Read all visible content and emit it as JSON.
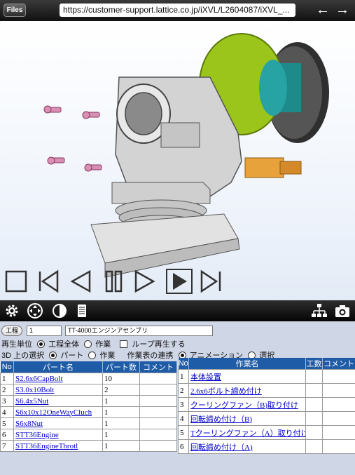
{
  "topbar": {
    "files_label": "Files",
    "url": "https://customer-support.lattice.co.jp/iXVL/L2604087/iXVL_...",
    "back_icon": "back-arrow-icon",
    "forward_icon": "forward-arrow-icon"
  },
  "player": {
    "buttons": [
      "stop",
      "rewind",
      "step-back",
      "pause",
      "step-forward",
      "play",
      "end"
    ]
  },
  "toolbar": {
    "left_icons": [
      "gear-icon",
      "move-icon",
      "contrast-icon",
      "list-icon"
    ],
    "right_icons": [
      "tree-icon",
      "camera-icon"
    ]
  },
  "panel": {
    "kotei_label": "工程",
    "process_number": "1",
    "assembly_name": "TT-4000エンジンアセンブリ",
    "row1": {
      "label": "再生単位",
      "opt1": "工程全体",
      "opt2": "作業",
      "loop": "ループ再生する"
    },
    "row2": {
      "label": "3D 上の選択",
      "opt1": "パート",
      "opt2": "作業",
      "link_label": "作業表の連携",
      "opt3": "アニメーション",
      "opt4": "選択"
    }
  },
  "parts_table": {
    "headers": [
      "No",
      "パート名",
      "パート数",
      "コメント"
    ],
    "rows": [
      [
        "1",
        "S2.6x6CapBolt",
        "10",
        ""
      ],
      [
        "2",
        "S3.0x10Bolt",
        "2",
        ""
      ],
      [
        "3",
        "S6.4x5Nut",
        "1",
        ""
      ],
      [
        "4",
        "S6x10x12OneWayCluch",
        "1",
        ""
      ],
      [
        "5",
        "S6x8Nut",
        "1",
        ""
      ],
      [
        "6",
        "STT36Engine",
        "1",
        ""
      ],
      [
        "7",
        "STT36EngineThrotl",
        "1",
        ""
      ]
    ]
  },
  "work_table": {
    "headers": [
      "No",
      "作業名",
      "工数",
      "コメント"
    ],
    "rows": [
      [
        "1",
        "本体設置",
        "",
        ""
      ],
      [
        "2",
        "2.6x6ボルト締め付け",
        "",
        ""
      ],
      [
        "3",
        "クーリングファン（B)取り付け",
        "",
        ""
      ],
      [
        "4",
        "回転締め付け（B)",
        "",
        ""
      ],
      [
        "5",
        "Tクーリングファン（A）取り付け",
        "",
        ""
      ],
      [
        "6",
        "回転締め付け（A)",
        "",
        ""
      ]
    ]
  }
}
